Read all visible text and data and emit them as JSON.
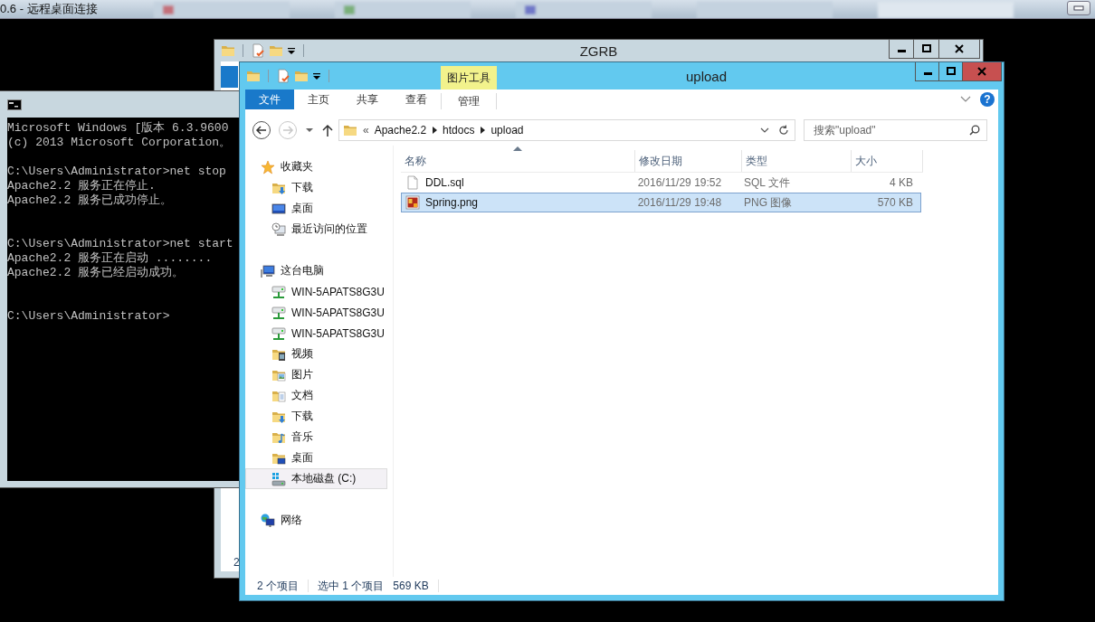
{
  "remote_desktop": {
    "title": "0.6 - 远程桌面连接"
  },
  "back_window": {
    "title": "ZGRB",
    "status_text": "2"
  },
  "console": {
    "blocks": [
      [
        "Microsoft Windows [版本 6.3.9600",
        "(c) 2013 Microsoft Corporation。"
      ],
      [
        "C:\\Users\\Administrator>net stop",
        "Apache2.2 服务正在停止.",
        "Apache2.2 服务已成功停止。"
      ],
      [
        "C:\\Users\\Administrator>net start",
        "Apache2.2 服务正在启动 ........",
        "Apache2.2 服务已经启动成功。"
      ],
      [
        "C:\\Users\\Administrator>"
      ]
    ]
  },
  "explorer": {
    "title": "upload",
    "tool_tab": "图片工具",
    "ribbon_tabs": [
      {
        "label": "文件",
        "kind": "file"
      },
      {
        "label": "主页",
        "kind": "normal"
      },
      {
        "label": "共享",
        "kind": "normal"
      },
      {
        "label": "查看",
        "kind": "normal"
      },
      {
        "label": "管理",
        "kind": "tool"
      }
    ],
    "help_button": "?",
    "nav_buttons": [
      {
        "kind": "back",
        "disabled": false
      },
      {
        "kind": "forward",
        "disabled": true
      }
    ],
    "address": {
      "overflow": "«",
      "segments": [
        "Apache2.2",
        "htdocs",
        "upload"
      ]
    },
    "search": {
      "placeholder": "搜索\"upload\""
    },
    "navigation": [
      {
        "label": "收藏夹",
        "kind": "favorites",
        "selected": false,
        "children": [
          {
            "label": "下载",
            "kind": "downloads",
            "selected": false
          },
          {
            "label": "桌面",
            "kind": "desktop",
            "selected": false
          },
          {
            "label": "最近访问的位置",
            "kind": "recent",
            "selected": false
          }
        ]
      },
      {
        "label": "这台电脑",
        "kind": "computer",
        "selected": false,
        "children": [
          {
            "label": "WIN-5APATS8G3U",
            "kind": "netdrive",
            "selected": false
          },
          {
            "label": "WIN-5APATS8G3U",
            "kind": "netdrive",
            "selected": false
          },
          {
            "label": "WIN-5APATS8G3U",
            "kind": "netdrive",
            "selected": false
          },
          {
            "label": "视频",
            "kind": "videos",
            "selected": false
          },
          {
            "label": "图片",
            "kind": "pictures",
            "selected": false
          },
          {
            "label": "文档",
            "kind": "documents",
            "selected": false
          },
          {
            "label": "下载",
            "kind": "downloads",
            "selected": false
          },
          {
            "label": "音乐",
            "kind": "music",
            "selected": false
          },
          {
            "label": "桌面",
            "kind": "desktopfolder",
            "selected": false
          },
          {
            "label": "本地磁盘 (C:)",
            "kind": "disk",
            "selected": true
          }
        ]
      },
      {
        "label": "网络",
        "kind": "network",
        "selected": false
      }
    ],
    "columns": [
      {
        "label": "名称",
        "sorted": true
      },
      {
        "label": "修改日期",
        "sorted": false
      },
      {
        "label": "类型",
        "sorted": false
      },
      {
        "label": "大小",
        "sorted": false
      }
    ],
    "files": [
      {
        "name": "DDL.sql",
        "kind": "text",
        "modified": "2016/11/29 19:52",
        "type": "SQL 文件",
        "size": "4 KB",
        "selected": false
      },
      {
        "name": "Spring.png",
        "kind": "image",
        "modified": "2016/11/29 19:48",
        "type": "PNG 图像",
        "size": "570 KB",
        "selected": true
      }
    ],
    "status_bar": {
      "item_count": "2 个项目",
      "selection": "选中 1 个项目",
      "size": "569 KB"
    }
  }
}
